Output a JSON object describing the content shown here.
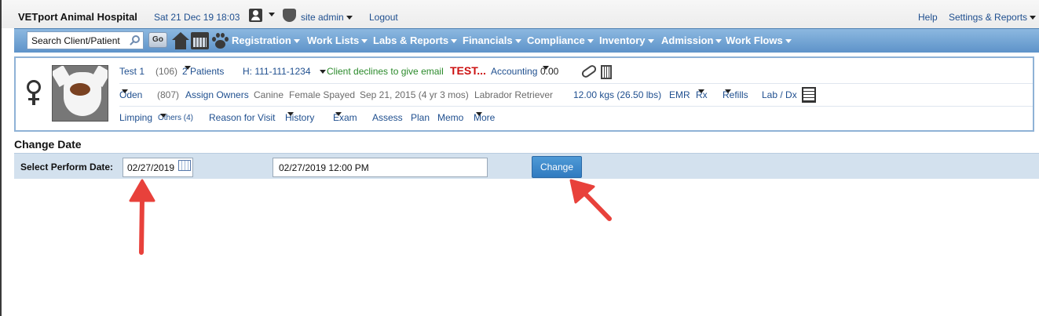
{
  "header": {
    "hospital_name": "VETport Animal Hospital",
    "datetime": "Sat 21 Dec 19 18:03",
    "user": "site admin",
    "logout": "Logout",
    "help": "Help",
    "settings": "Settings & Reports"
  },
  "nav": {
    "search_placeholder": "Search Client/Patient",
    "go": "Go",
    "items": [
      "Registration",
      "Work Lists",
      "Labs & Reports",
      "Financials",
      "Compliance",
      "Inventory",
      "Admission",
      "Work Flows"
    ]
  },
  "client": {
    "name": "Test 1",
    "id": "(106)",
    "patients": "2  Patients",
    "phone": "H: 111-111-1234",
    "email_note": "Client declines to give email",
    "flag": "TEST...",
    "accounting_label": "Accounting",
    "accounting_value": "0.00"
  },
  "patient": {
    "name": "Oden",
    "id": "(807)",
    "assign_owners": "Assign Owners",
    "species": "Canine",
    "sex": "Female Spayed",
    "dob": "Sep 21, 2015 (4 yr 3 mos)",
    "breed": "Labrador Retriever",
    "weight": "12.00 kgs (26.50 lbs)",
    "emr": "EMR",
    "rx": "Rx",
    "refills": "Refills",
    "lab_dx": "Lab / Dx"
  },
  "visit": {
    "complaint": "Limping",
    "others": "Others (4)",
    "reason": "Reason for Visit",
    "history": "History",
    "exam": "Exam",
    "assess": "Assess",
    "plan": "Plan",
    "memo": "Memo",
    "more": "More"
  },
  "change_date": {
    "title": "Change Date",
    "label": "Select Perform Date:",
    "date_value": "02/27/2019",
    "datetime_value": "02/27/2019 12:00 PM",
    "button": "Change"
  },
  "colors": {
    "nav_bar": "#6b9fd2",
    "form_bar": "#d3e1ee",
    "button": "#3a87c9",
    "arrow": "#e8413b"
  }
}
